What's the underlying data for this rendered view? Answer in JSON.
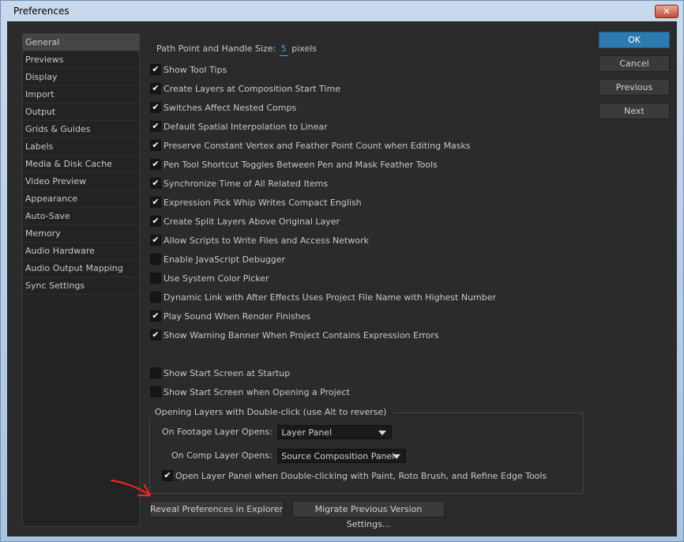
{
  "window": {
    "title": "Preferences",
    "close_glyph": "✕"
  },
  "sidebar": {
    "items": [
      {
        "label": "General",
        "active": true
      },
      {
        "label": "Previews"
      },
      {
        "label": "Display"
      },
      {
        "label": "Import"
      },
      {
        "label": "Output"
      },
      {
        "label": "Grids & Guides"
      },
      {
        "label": "Labels"
      },
      {
        "label": "Media & Disk Cache"
      },
      {
        "label": "Video Preview"
      },
      {
        "label": "Appearance"
      },
      {
        "label": "Auto-Save"
      },
      {
        "label": "Memory"
      },
      {
        "label": "Audio Hardware"
      },
      {
        "label": "Audio Output Mapping"
      },
      {
        "label": "Sync Settings"
      }
    ]
  },
  "general": {
    "path_point": {
      "label": "Path Point and Handle Size:",
      "value": "5",
      "unit": "pixels"
    },
    "checkboxes": [
      {
        "label": "Show Tool Tips",
        "checked": true
      },
      {
        "label": "Create Layers at Composition Start Time",
        "checked": true
      },
      {
        "label": "Switches Affect Nested Comps",
        "checked": true
      },
      {
        "label": "Default Spatial Interpolation to Linear",
        "checked": true
      },
      {
        "label": "Preserve Constant Vertex and Feather Point Count when Editing Masks",
        "checked": true
      },
      {
        "label": "Pen Tool Shortcut Toggles Between Pen and Mask Feather Tools",
        "checked": true
      },
      {
        "label": "Synchronize Time of All Related Items",
        "checked": true
      },
      {
        "label": "Expression Pick Whip Writes Compact English",
        "checked": true
      },
      {
        "label": "Create Split Layers Above Original Layer",
        "checked": true
      },
      {
        "label": "Allow Scripts to Write Files and Access Network",
        "checked": true
      },
      {
        "label": "Enable JavaScript Debugger",
        "checked": false
      },
      {
        "label": "Use System Color Picker",
        "checked": false
      },
      {
        "label": "Dynamic Link with After Effects Uses Project File Name with Highest Number",
        "checked": false
      },
      {
        "label": "Play Sound When Render Finishes",
        "checked": true
      },
      {
        "label": "Show Warning Banner When Project Contains Expression Errors",
        "checked": true
      }
    ],
    "startup": [
      {
        "label": "Show Start Screen at Startup",
        "checked": false
      },
      {
        "label": "Show Start Screen when Opening a Project",
        "checked": false
      }
    ],
    "opening_layers": {
      "title": "Opening Layers with Double-click (use Alt to reverse)",
      "footage": {
        "label": "On Footage Layer Opens:",
        "value": "Layer Panel"
      },
      "comp": {
        "label": "On Comp Layer Opens:",
        "value": "Source Composition Panel"
      },
      "paint": {
        "label": "Open Layer Panel when Double-clicking with Paint, Roto Brush, and Refine Edge Tools",
        "checked": true
      }
    },
    "bottom_buttons": {
      "reveal": "Reveal Preferences in Explorer",
      "migrate": "Migrate Previous Version Settings..."
    }
  },
  "actions": {
    "ok": "OK",
    "cancel": "Cancel",
    "previous": "Previous",
    "next": "Next"
  },
  "colors": {
    "accent": "#2c7ab0",
    "annotation_arrow": "#e8261f",
    "value_highlight": "#3fa5ff"
  },
  "icons": {
    "check_glyph": "✔"
  }
}
